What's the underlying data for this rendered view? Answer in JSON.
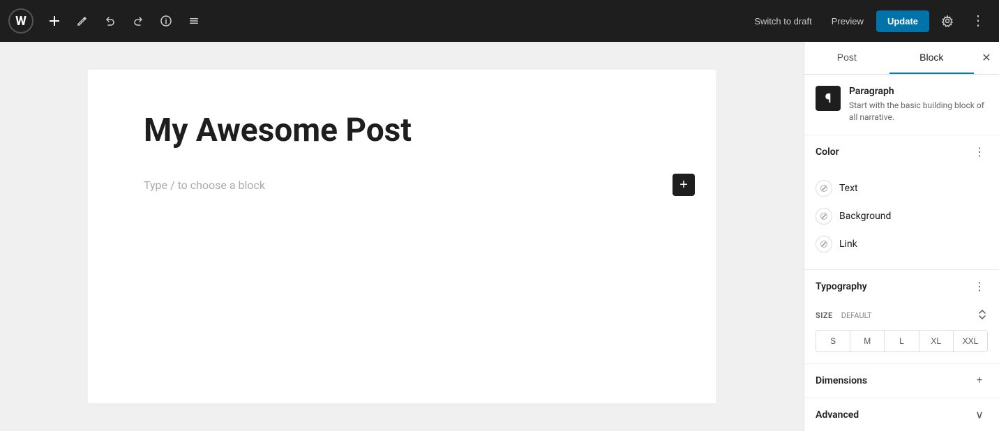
{
  "toolbar": {
    "logo_symbol": "W",
    "add_label": "+",
    "edit_label": "✏",
    "undo_label": "↺",
    "redo_label": "↻",
    "info_label": "ℹ",
    "list_label": "≡",
    "switch_draft_label": "Switch to draft",
    "preview_label": "Preview",
    "update_label": "Update",
    "settings_label": "⚙",
    "more_label": "⋮"
  },
  "editor": {
    "post_title": "My Awesome Post",
    "block_placeholder": "Type / to choose a block",
    "add_block_label": "+"
  },
  "sidebar": {
    "tab_post_label": "Post",
    "tab_block_label": "Block",
    "close_label": "✕",
    "active_tab": "Block",
    "block_icon": "¶",
    "block_name": "Paragraph",
    "block_description": "Start with the basic building block of all narrative.",
    "color_section": {
      "title": "Color",
      "more_options_label": "⋮",
      "options": [
        {
          "label": "Text"
        },
        {
          "label": "Background"
        },
        {
          "label": "Link"
        }
      ]
    },
    "typography_section": {
      "title": "Typography",
      "more_options_label": "⋮",
      "size_label": "SIZE",
      "size_default": "DEFAULT",
      "size_controls_label": "⇅",
      "sizes": [
        "S",
        "M",
        "L",
        "XL",
        "XXL"
      ]
    },
    "dimensions_section": {
      "title": "Dimensions",
      "expand_label": "+"
    },
    "advanced_section": {
      "title": "Advanced",
      "collapse_label": "∨"
    }
  }
}
